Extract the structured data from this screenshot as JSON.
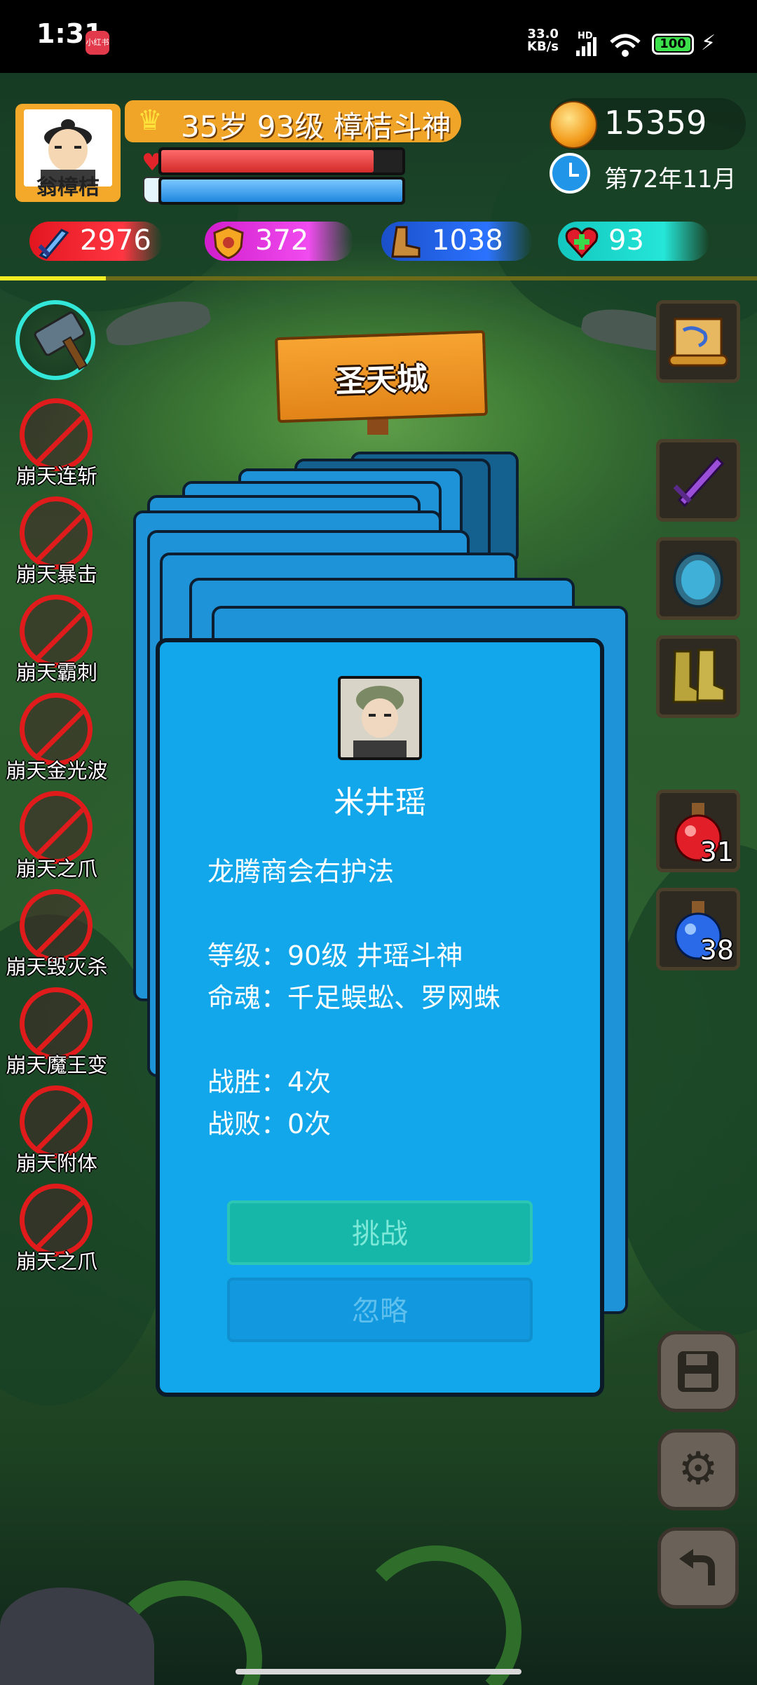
{
  "status_bar": {
    "time": "1:31",
    "badge": "小红书",
    "net_speed": "33.0",
    "net_unit": "KB/s",
    "hd": "HD",
    "battery": "100"
  },
  "player": {
    "name": "翁樟桔",
    "title": "35岁 93级 樟桔斗神",
    "hp_fraction": 0.88,
    "mp_fraction": 1.0,
    "gold": "15359",
    "date": "第72年11月"
  },
  "stats": {
    "attack": "2976",
    "defense": "372",
    "speed": "1038",
    "health": "93"
  },
  "location": "圣天城",
  "skills": [
    {
      "label": "崩天连斩"
    },
    {
      "label": "崩天暴击"
    },
    {
      "label": "崩天霸刺"
    },
    {
      "label": "崩天金光波"
    },
    {
      "label": "崩天之爪"
    },
    {
      "label": "崩天毁灭杀"
    },
    {
      "label": "崩天魔王变"
    },
    {
      "label": "崩天附体"
    },
    {
      "label": "崩天之爪"
    }
  ],
  "items": {
    "red_potion_count": "31",
    "blue_potion_count": "38"
  },
  "encounter": {
    "name": "米井瑶",
    "role": "龙腾商会右护法",
    "level": "等级：90级 井瑶斗神",
    "soul": "命魂：千足蜈蚣、罗网蛛",
    "wins": "战胜：4次",
    "losses": "战败：0次",
    "challenge_label": "挑战",
    "ignore_label": "忽略"
  }
}
